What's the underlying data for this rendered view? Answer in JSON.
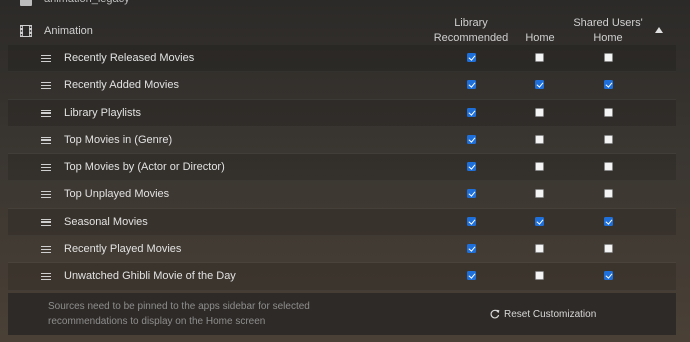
{
  "library": {
    "label": "animation_legacy",
    "icon": "library-icon"
  },
  "section": {
    "title": "Animation",
    "icon": "film-icon"
  },
  "columns": {
    "recommended": {
      "line1": "Library",
      "line2": "Recommended"
    },
    "home": {
      "line1": "",
      "line2": "Home"
    },
    "shared": {
      "line1": "Shared Users'",
      "line2": "Home"
    }
  },
  "rows": [
    {
      "label": "Recently Released Movies",
      "recommended": true,
      "home": false,
      "shared": false
    },
    {
      "label": "Recently Added Movies",
      "recommended": true,
      "home": true,
      "shared": true
    },
    {
      "label": "Library Playlists",
      "recommended": true,
      "home": false,
      "shared": false
    },
    {
      "label": "Top Movies in (Genre)",
      "recommended": true,
      "home": false,
      "shared": false
    },
    {
      "label": "Top Movies by (Actor or Director)",
      "recommended": true,
      "home": false,
      "shared": false
    },
    {
      "label": "Top Unplayed Movies",
      "recommended": true,
      "home": false,
      "shared": false
    },
    {
      "label": "Seasonal Movies",
      "recommended": true,
      "home": true,
      "shared": true
    },
    {
      "label": "Recently Played Movies",
      "recommended": true,
      "home": false,
      "shared": false
    },
    {
      "label": "Unwatched Ghibli Movie of the Day",
      "recommended": true,
      "home": false,
      "shared": true
    }
  ],
  "footer": {
    "note": "Sources need to be pinned to the apps sidebar for selected recommendations to display on the Home screen",
    "reset_label": "Reset Customization",
    "reset_icon": "refresh-icon"
  },
  "colors": {
    "checked": "#1e6fd9",
    "unchecked": "#f4f4f4"
  }
}
